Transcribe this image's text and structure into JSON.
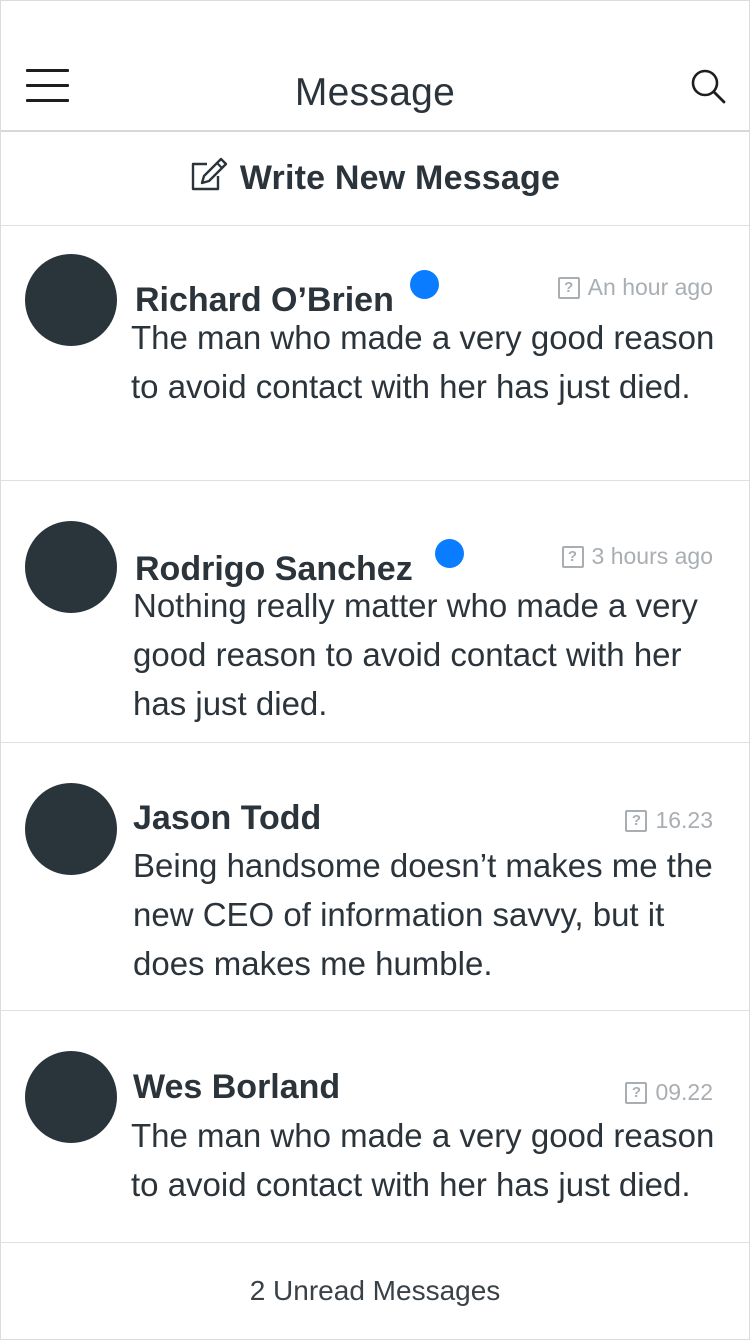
{
  "header": {
    "title": "Message",
    "menu_icon": "hamburger-menu-icon",
    "search_icon": "search-icon"
  },
  "compose": {
    "label": "Write New Message",
    "icon": "edit-icon"
  },
  "messages": [
    {
      "name": "Richard O’Brien",
      "unread": true,
      "time": "An hour ago",
      "body": "The man who made a very good reason to avoid contact with her has just died."
    },
    {
      "name": "Rodrigo Sanchez",
      "unread": true,
      "time": "3 hours ago",
      "body": "Nothing really matter who made a very good reason to avoid contact with her has just died."
    },
    {
      "name": "Jason Todd",
      "unread": false,
      "time": "16.23",
      "body": "Being handsome doesn’t makes me the new CEO of information savvy, but it does makes me humble."
    },
    {
      "name": "Wes Borland",
      "unread": false,
      "time": "09.22",
      "body": "The man who made a very good reason to avoid contact with her has just died."
    }
  ],
  "footer": {
    "label": "2 Unread Messages"
  },
  "colors": {
    "unread_dot": "#0a7cff",
    "avatar": "#2a343b",
    "text": "#2b333b",
    "muted": "#a9aeb3"
  }
}
